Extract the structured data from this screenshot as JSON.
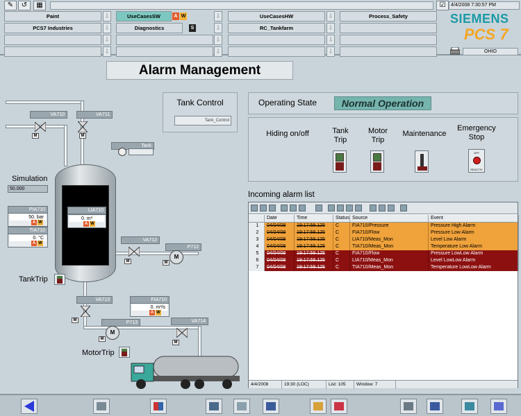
{
  "header": {
    "datetime": "4/4/2008 7:30:57 PM",
    "brand": "SIEMENS",
    "product": "PCS 7",
    "server": "OHIO"
  },
  "areas": {
    "row1": [
      "Paint",
      "UseCasesSW",
      "UseCasesHW",
      "Process_Safety"
    ],
    "row2": [
      "PCS7 Industries",
      "Diagnostics",
      "RC_Tankfarm",
      ""
    ],
    "alarm_letters": [
      "A",
      "W",
      "S"
    ]
  },
  "page": {
    "title": "Alarm Management"
  },
  "tank_control": {
    "title": "Tank Control",
    "faceplate_label": "Tank_Control"
  },
  "operating": {
    "label": "Operating State",
    "value": "Normal Operation"
  },
  "controls": {
    "hiding": "Hiding on/off",
    "tank_trip_1": "Tank",
    "tank_trip_2": "Trip",
    "motor_trip_1": "Motor",
    "motor_trip_2": "Trip",
    "maintenance": "Maintenance",
    "estop_1": "Emergency",
    "estop_2": "Stop",
    "estop_off": "OFF",
    "estop_reactiv": "REACTIV"
  },
  "alarm_list": {
    "title": "Incoming alarm list",
    "columns": [
      "",
      "Date",
      "Time",
      "Status",
      "Source",
      "Event"
    ],
    "rows": [
      {
        "n": "1",
        "date": "04/04/08",
        "time": "19:17:58.125",
        "status": "C",
        "source": "FIA710/Pressure",
        "event": "Pressure High Alarm",
        "bg": "#f0a23b",
        "fg": "#000000"
      },
      {
        "n": "2",
        "date": "04/04/08",
        "time": "19:17:58.125",
        "status": "C",
        "source": "FIA710/Flow",
        "event": "Pressure Low Alarm",
        "bg": "#f0a23b",
        "fg": "#000000"
      },
      {
        "n": "3",
        "date": "04/04/08",
        "time": "19:17:58.125",
        "status": "C",
        "source": "LIA710/Meas_Mon",
        "event": "Level Low Alarm",
        "bg": "#f0a23b",
        "fg": "#000000"
      },
      {
        "n": "4",
        "date": "04/04/08",
        "time": "19:17:58.125",
        "status": "C",
        "source": "TIA710/Meas_Mon",
        "event": "Temperature Low Alarm",
        "bg": "#f0a23b",
        "fg": "#000000"
      },
      {
        "n": "5",
        "date": "04/04/08",
        "time": "19:17:58.125",
        "status": "C",
        "source": "FIA710/Flow",
        "event": "Pressure LowLow Alarm",
        "bg": "#8c1010",
        "fg": "#ffffff"
      },
      {
        "n": "6",
        "date": "04/04/08",
        "time": "19:17:58.125",
        "status": "C",
        "source": "LIA710/Meas_Mon",
        "event": "Level LowLow Alarm",
        "bg": "#8c1010",
        "fg": "#ffffff"
      },
      {
        "n": "7",
        "date": "04/04/08",
        "time": "19:17:58.125",
        "status": "C",
        "source": "TIA710/Meas_Mon",
        "event": "Temperature LowLow Alarm",
        "bg": "#8c1010",
        "fg": "#ffffff"
      }
    ],
    "status_bar": [
      "4/4/2008",
      "19:30 (LOC)",
      "List: 105",
      "Window: 7"
    ]
  },
  "process": {
    "va710": "VA710",
    "va711": "VA711",
    "tank_tag": "Tank",
    "simulation": "Simulation",
    "sim_value": "50.000",
    "pia710": "PIA710",
    "pia_value": "50. bar",
    "tia710": "TIA710",
    "tia_value": "0. °C",
    "lia710": "LIA710",
    "lia_value": "0. m³",
    "va712": "VA712",
    "p712": "P712",
    "va713": "VA713",
    "fia710": "FIA710",
    "fia_value": "0. m³/s",
    "p713": "P713",
    "va714": "VA714",
    "tanktrip": "TankTrip",
    "motortrip": "MotorTrip",
    "m": "M",
    "a": "A",
    "w": "W"
  }
}
